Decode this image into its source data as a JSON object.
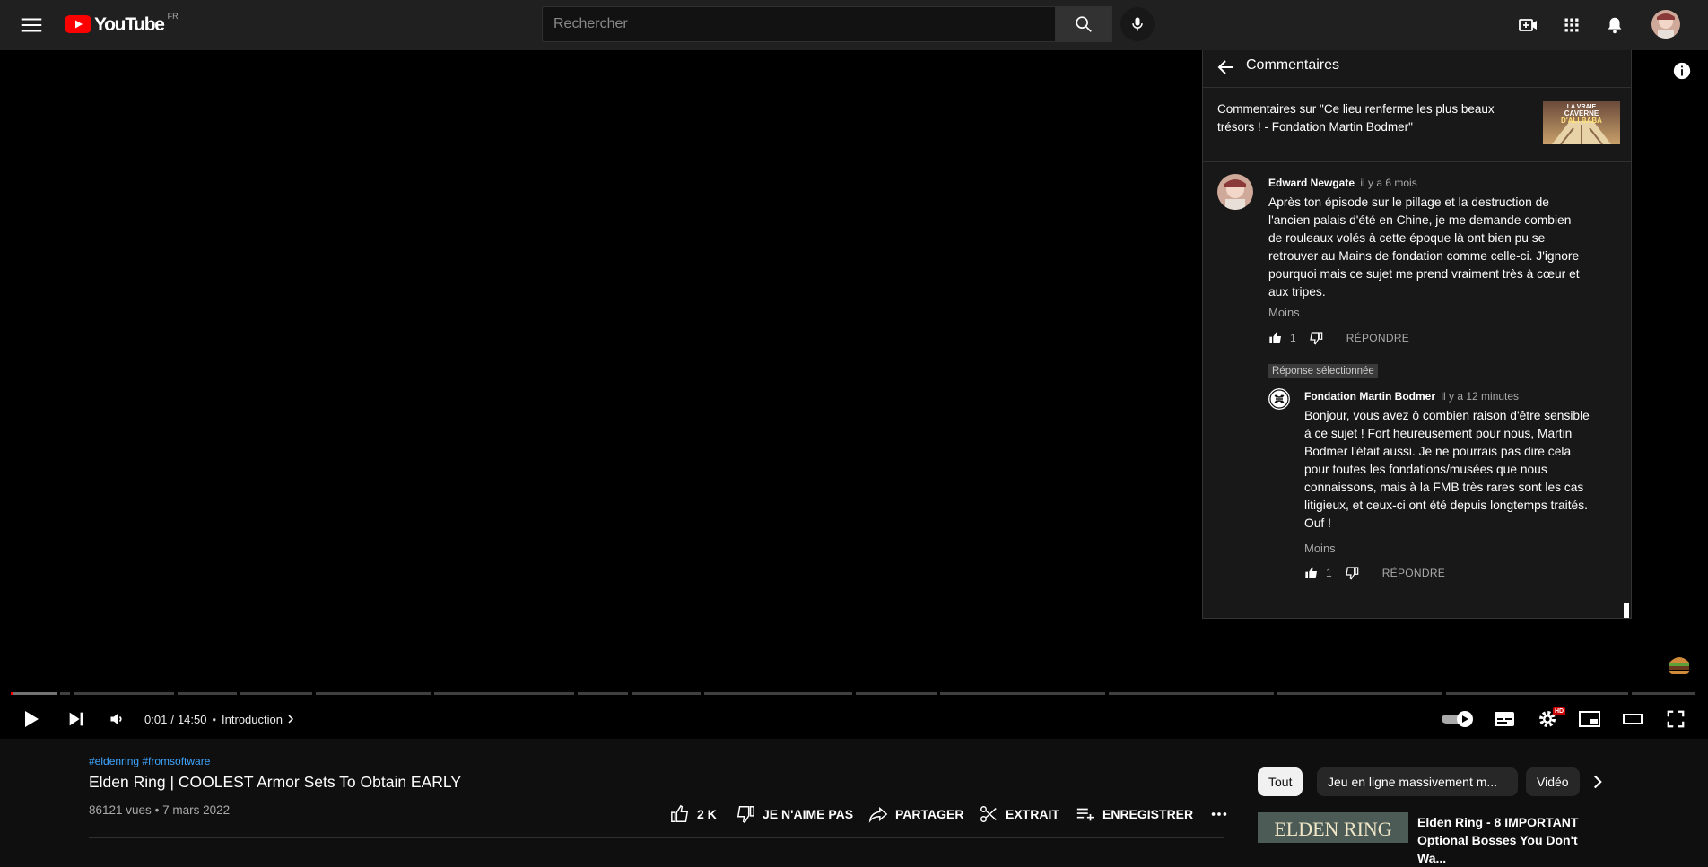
{
  "topbar": {
    "logo_text": "YouTube",
    "country_code": "FR",
    "search_placeholder": "Rechercher",
    "icons": [
      "menu-icon",
      "search-icon",
      "mic-icon",
      "create-video-icon",
      "apps-icon",
      "notifications-icon"
    ]
  },
  "player": {
    "time_current": "0:01",
    "time_separator": "/",
    "time_total": "14:50",
    "chapter_separator": "•",
    "chapter": "Introduction",
    "settings_badge": "HD",
    "progress_played": 0.001,
    "chapter_segments": [
      [
        0.0,
        0.028
      ],
      [
        0.029,
        0.036
      ],
      [
        0.037,
        0.098
      ],
      [
        0.099,
        0.135
      ],
      [
        0.136,
        0.18
      ],
      [
        0.181,
        0.25
      ],
      [
        0.251,
        0.335
      ],
      [
        0.336,
        0.367
      ],
      [
        0.368,
        0.41
      ],
      [
        0.411,
        0.5
      ],
      [
        0.501,
        0.55
      ],
      [
        0.551,
        0.65
      ],
      [
        0.651,
        0.75
      ],
      [
        0.751,
        0.85
      ],
      [
        0.851,
        0.96
      ],
      [
        0.961,
        1.0
      ]
    ]
  },
  "comments_panel": {
    "title": "Commentaires",
    "video_context": "Commentaires sur \"Ce lieu renferme les plus beaux trésors ! - Fondation Martin Bodmer\"",
    "thumbnail_text_1": "LA VRAIE",
    "thumbnail_text_2": "CAVERNE",
    "thumbnail_text_3": "D'ALI BABA",
    "comment": {
      "author": "Edward Newgate",
      "time": "il y a 6 mois",
      "text": "Après ton épisode sur le pillage et la destruction de l'ancien palais d'été en Chine, je me demande combien de rouleaux volés à cette époque là ont bien pu se retrouver au Mains de fondation comme celle-ci. J'ignore pourquoi mais ce sujet me prend vraiment très à cœur et aux tripes.",
      "less_label": "Moins",
      "likes": "1",
      "reply_label": "RÉPONDRE"
    },
    "selected_reply_badge": "Réponse sélectionnée",
    "reply": {
      "author": "Fondation Martin Bodmer",
      "time": "il y a 12 minutes",
      "text": "Bonjour, vous avez ô combien raison d'être sensible à ce sujet ! Fort heureusement pour nous, Martin Bodmer l'était aussi. Je ne pourrais pas dire cela pour toutes les fondations/musées que nous connaissons, mais à la FMB très rares sont les cas litigieux, et ceux-ci ont été depuis longtemps traités. Ouf !",
      "less_label": "Moins",
      "likes": "1",
      "reply_label": "RÉPONDRE"
    }
  },
  "video": {
    "hashtags": "#eldenring #fromsoftware",
    "title": "Elden Ring | COOLEST Armor Sets To Obtain EARLY",
    "views": "86121 vues",
    "meta_separator": "•",
    "date": "7 mars 2022",
    "like_count": "2 K",
    "dislike_label": "JE N'AIME PAS",
    "share_label": "PARTAGER",
    "clip_label": "EXTRAIT",
    "save_label": "ENREGISTRER"
  },
  "sidebar": {
    "chips": [
      "Tout",
      "Jeu en ligne massivement m...",
      "Vidéo"
    ],
    "recommendation": {
      "thumbnail_text": "ELDEN RING",
      "title": "Elden Ring - 8 IMPORTANT Optional Bosses You Don't Wa..."
    }
  },
  "colors": {
    "topbar_bg": "#202020",
    "page_bg": "#0f0f0f",
    "panel_bg": "#181818",
    "link_blue": "#3ea6ff",
    "logo_red": "#ff0000",
    "badge_red": "#cc0000"
  }
}
